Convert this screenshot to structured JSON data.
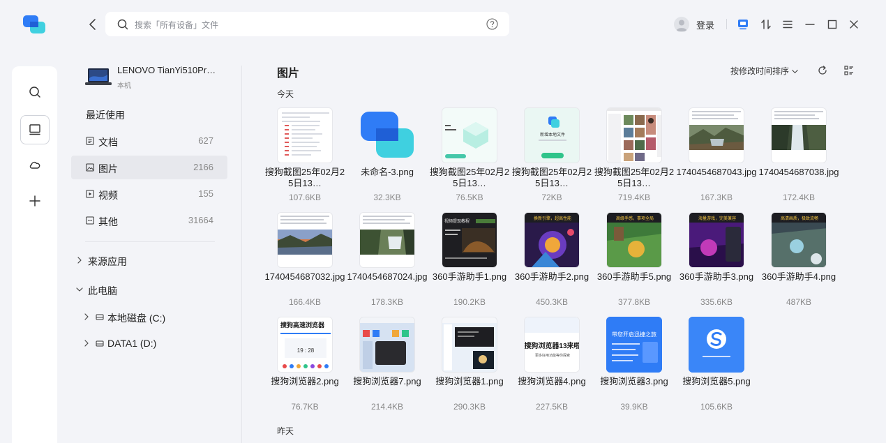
{
  "search": {
    "placeholder": "搜索「所有设备」文件"
  },
  "header": {
    "login_label": "登录"
  },
  "device": {
    "name": "LENOVO TianYi510Pr…",
    "subtitle": "本机"
  },
  "nav": {
    "recent_title": "最近使用",
    "items": [
      {
        "label": "文档",
        "count": "627",
        "icon": "document-icon"
      },
      {
        "label": "图片",
        "count": "2166",
        "icon": "image-icon"
      },
      {
        "label": "视频",
        "count": "155",
        "icon": "video-icon"
      },
      {
        "label": "其他",
        "count": "31664",
        "icon": "other-icon"
      }
    ],
    "source_apps": "来源应用",
    "this_pc": "此电脑",
    "drives": [
      {
        "label": "本地磁盘 (C:)"
      },
      {
        "label": "DATA1 (D:)"
      }
    ]
  },
  "main": {
    "title": "图片",
    "sort_label": "按修改时间排序",
    "today_label": "今天",
    "yesterday_label": "昨天",
    "files": [
      {
        "name": "搜狗截图25年02月25日13…",
        "size": "107.6KB",
        "thumb": "doc"
      },
      {
        "name": "未命名-3.png",
        "size": "32.3KB",
        "thumb": "logo"
      },
      {
        "name": "搜狗截图25年02月25日13…",
        "size": "76.5KB",
        "thumb": "teal"
      },
      {
        "name": "搜狗截图25年02月25日13…",
        "size": "72KB",
        "thumb": "dialog"
      },
      {
        "name": "搜狗截图25年02月25日13…",
        "size": "719.4KB",
        "thumb": "photos"
      },
      {
        "name": "1740454687043.jpg",
        "size": "167.3KB",
        "thumb": "land-a"
      },
      {
        "name": "1740454687038.jpg",
        "size": "172.4KB",
        "thumb": "land-b"
      },
      {
        "name": "1740454687032.jpg",
        "size": "166.4KB",
        "thumb": "land-c"
      },
      {
        "name": "1740454687024.jpg",
        "size": "178.3KB",
        "thumb": "land-d"
      },
      {
        "name": "360手游助手1.png",
        "size": "190.2KB",
        "thumb": "dark"
      },
      {
        "name": "360手游助手2.png",
        "size": "450.3KB",
        "thumb": "game-a"
      },
      {
        "name": "360手游助手5.png",
        "size": "377.8KB",
        "thumb": "game-b"
      },
      {
        "name": "360手游助手3.png",
        "size": "335.6KB",
        "thumb": "game-c"
      },
      {
        "name": "360手游助手4.png",
        "size": "487KB",
        "thumb": "game-d"
      },
      {
        "name": "搜狗浏览器2.png",
        "size": "76.7KB",
        "thumb": "browser-a"
      },
      {
        "name": "搜狗浏览器7.png",
        "size": "214.4KB",
        "thumb": "browser-b"
      },
      {
        "name": "搜狗浏览器1.png",
        "size": "290.3KB",
        "thumb": "browser-c"
      },
      {
        "name": "搜狗浏览器4.png",
        "size": "227.5KB",
        "thumb": "browser-d"
      },
      {
        "name": "搜狗浏览器3.png",
        "size": "39.9KB",
        "thumb": "browser-e"
      },
      {
        "name": "搜狗浏览器5.png",
        "size": "105.6KB",
        "thumb": "browser-f"
      }
    ]
  },
  "thumb_text": {
    "browser_a": "搜狗高速浏览器",
    "browser_a_time": "19 : 28",
    "browser_d": "搜狗浏览器13来啦",
    "browser_d_small": "更多好用功能等你探索",
    "browser_e": "带您开启迅捷之旅",
    "dialog": "新增本地文件",
    "game_a": "换新引擎，超高性能",
    "game_b": "高级手感，事项全局",
    "game_c": "海量游戏，完美兼容",
    "game_d": "高清画质，极致流畅",
    "dark": "视频提现教程"
  },
  "colors": {
    "accent": "#1677ff",
    "logo_blue": "#2f7cf6",
    "logo_cyan": "#3fd0e0"
  }
}
